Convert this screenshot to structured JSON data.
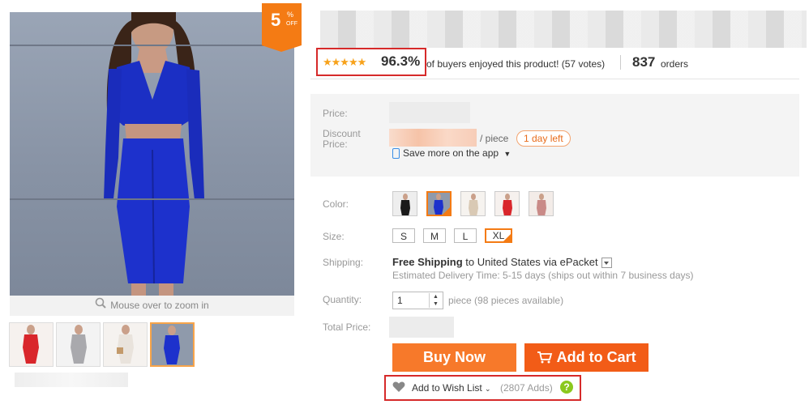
{
  "badge": {
    "number": "5",
    "percent": "%",
    "off": "OFF"
  },
  "gallery": {
    "zoom_hint": "Mouse over to zoom in",
    "thumbnails": [
      "red dress",
      "grey dress",
      "white dress",
      "blue dress"
    ],
    "active_thumbnail": 3
  },
  "rating": {
    "stars": "★★★★★",
    "percent": "96.3%",
    "buyers_text": "of buyers enjoyed this product! (57 votes)",
    "orders_count": "837",
    "orders_label": "orders"
  },
  "price": {
    "price_label": "Price:",
    "discount_label_line1": "Discount",
    "discount_label_line2": "Price:",
    "per_piece": "/ piece",
    "timer": "1 day left",
    "app_promo": "Save more on the app"
  },
  "options": {
    "color_label": "Color:",
    "colors": [
      "black",
      "royal blue",
      "beige",
      "red",
      "pink"
    ],
    "selected_color": 1,
    "size_label": "Size:",
    "sizes": [
      "S",
      "M",
      "L",
      "XL"
    ],
    "selected_size": 3,
    "shipping_label": "Shipping:",
    "shipping_bold": "Free Shipping",
    "shipping_dest": "to  United States via ePacket",
    "delivery_time": "Estimated Delivery Time: 5-15 days (ships out within 7 business days)",
    "quantity_label": "Quantity:",
    "quantity_value": "1",
    "quantity_note": "piece (98 pieces available)",
    "total_label": "Total Price:"
  },
  "actions": {
    "buy_now": "Buy Now",
    "add_to_cart": "Add to Cart",
    "wishlist": "Add to Wish List",
    "wishlist_count": "(2807 Adds)",
    "help": "?"
  },
  "colors": {
    "accent": "#f47b14",
    "buy": "#f7792a",
    "cart": "#f25c17",
    "highlight_box": "#d62a2a",
    "star": "#f7a21b"
  }
}
